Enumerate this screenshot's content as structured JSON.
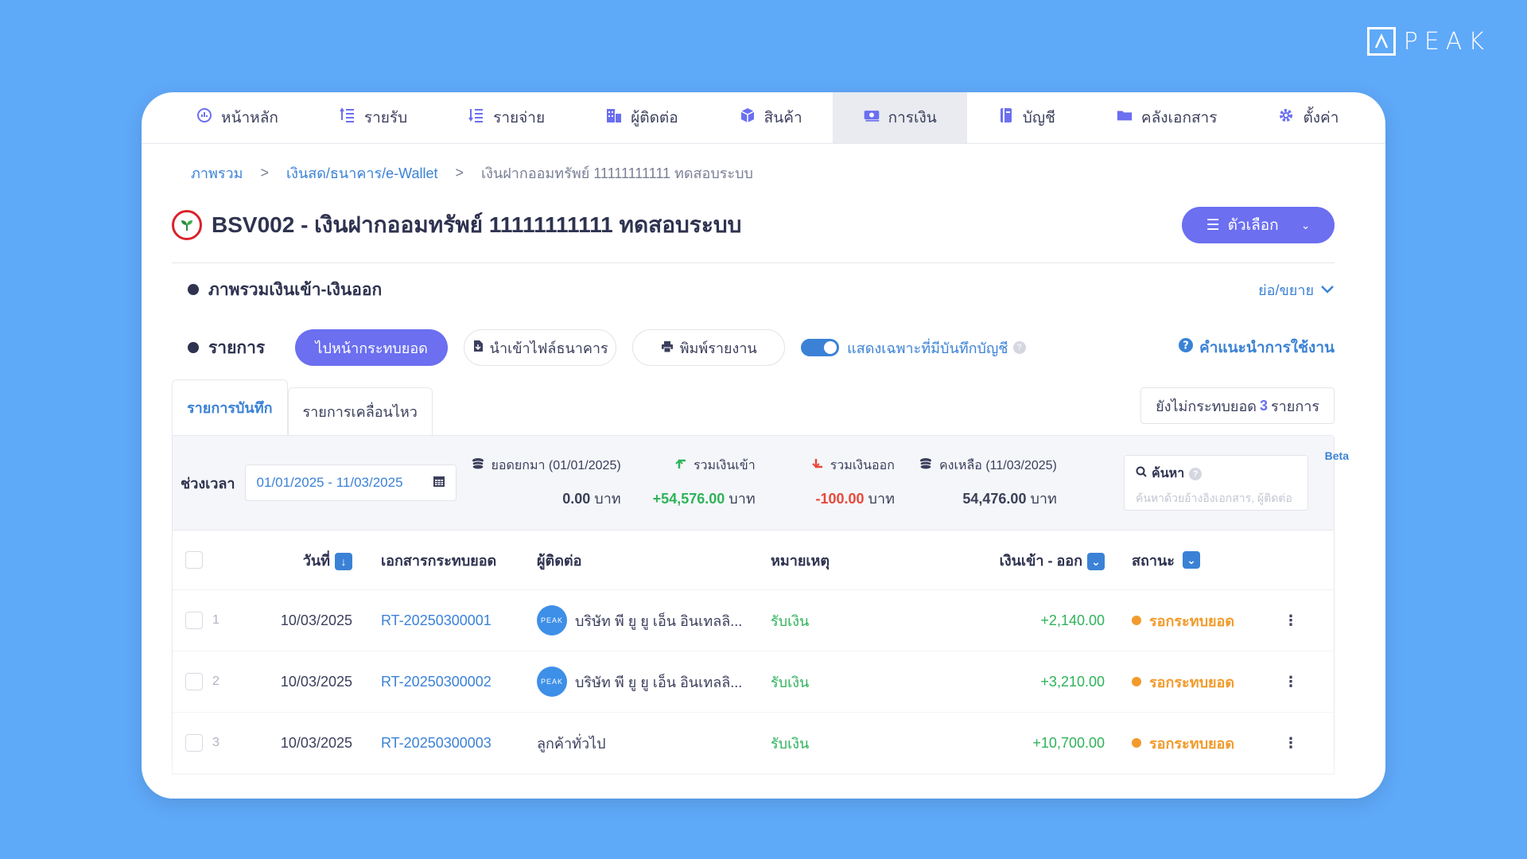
{
  "brand": {
    "name": "PEAK"
  },
  "nav": [
    {
      "label": "หน้าหลัก",
      "icon": "dashboard-icon"
    },
    {
      "label": "รายรับ",
      "icon": "income-icon"
    },
    {
      "label": "รายจ่าย",
      "icon": "expense-icon"
    },
    {
      "label": "ผู้ติดต่อ",
      "icon": "contacts-icon"
    },
    {
      "label": "สินค้า",
      "icon": "product-box-icon"
    },
    {
      "label": "การเงิน",
      "icon": "money-icon"
    },
    {
      "label": "บัญชี",
      "icon": "accounting-book-icon"
    },
    {
      "label": "คลังเอกสาร",
      "icon": "folder-icon"
    },
    {
      "label": "ตั้งค่า",
      "icon": "gear-icon"
    }
  ],
  "breadcrumb": {
    "items": [
      "ภาพรวม",
      "เงินสด/ธนาคาร/e-Wallet"
    ],
    "separator": ">",
    "current": "เงินฝากออมทรัพย์ 11111111111 ทดสอบระบบ"
  },
  "page": {
    "title": "BSV002 - เงินฝากออมทรัพย์ 11111111111 ทดสอบระบบ",
    "options_label": "ตัวเลือก"
  },
  "overview": {
    "title": "ภาพรวมเงินเข้า-เงินออก",
    "collapse_label": "ย่อ/ขยาย"
  },
  "transactions": {
    "title": "รายการ",
    "reconcile_button": "ไปหน้ากระทบยอด",
    "import_button": "นำเข้าไฟล์ธนาคาร",
    "print_button": "พิมพ์รายงาน",
    "toggle_label": "แสดงเฉพาะที่มีบันทึกบัญชี",
    "guide_label": "คำแนะนำการใช้งาน",
    "beta_label": "Beta"
  },
  "tabs": [
    {
      "label": "รายการบันทึก",
      "active": true
    },
    {
      "label": "รายการเคลื่อนไหว",
      "active": false
    }
  ],
  "pending": {
    "prefix": "ยังไม่กระทบยอด",
    "count": "3",
    "suffix": "รายการ"
  },
  "stats": {
    "period_label": "ช่วงเวลา",
    "date_range": "01/01/2025 - 11/03/2025",
    "opening": {
      "label": "ยอดยกมา (01/01/2025)",
      "value": "0.00",
      "unit": "บาท"
    },
    "inflow": {
      "label": "รวมเงินเข้า",
      "value": "+54,576.00",
      "unit": "บาท",
      "color": "#2eb35a"
    },
    "outflow": {
      "label": "รวมเงินออก",
      "value": "-100.00",
      "unit": "บาท",
      "color": "#e8483b"
    },
    "balance": {
      "label": "คงเหลือ (11/03/2025)",
      "value": "54,476.00",
      "unit": "บาท"
    }
  },
  "search": {
    "label": "ค้นหา",
    "placeholder": "ค้นหาด้วยอ้างอิงเอกสาร, ผู้ติดต่อ"
  },
  "table": {
    "headers": {
      "date": "วันที่",
      "doc": "เอกสารกระทบยอด",
      "contact": "ผู้ติดต่อ",
      "note": "หมายเหตุ",
      "amount": "เงินเข้า - ออก",
      "status": "สถานะ"
    },
    "rows": [
      {
        "no": "1",
        "date": "10/03/2025",
        "doc": "RT-20250300001",
        "contact": "บริษัท พี ยู ยู เอ็น อินเทลลิ...",
        "avatar": "PEAK",
        "note": "รับเงิน",
        "amount": "+2,140.00",
        "status": "รอกระทบยอด"
      },
      {
        "no": "2",
        "date": "10/03/2025",
        "doc": "RT-20250300002",
        "contact": "บริษัท พี ยู ยู เอ็น อินเทลลิ...",
        "avatar": "PEAK",
        "note": "รับเงิน",
        "amount": "+3,210.00",
        "status": "รอกระทบยอด"
      },
      {
        "no": "3",
        "date": "10/03/2025",
        "doc": "RT-20250300003",
        "contact": "ลูกค้าทั่วไป",
        "avatar": "",
        "note": "รับเงิน",
        "amount": "+10,700.00",
        "status": "รอกระทบยอด"
      }
    ]
  },
  "colors": {
    "background": "#5fa9f9",
    "accent": "#6b6ff0",
    "link": "#3b82d6",
    "positive": "#2eb35a",
    "negative": "#e8483b",
    "pending": "#f29b2c"
  }
}
